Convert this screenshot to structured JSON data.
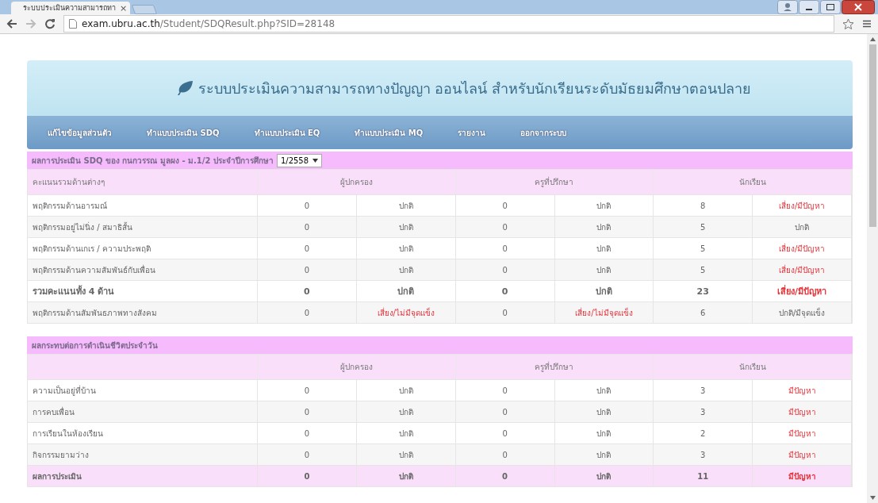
{
  "browser": {
    "tab": {
      "title": "ระบบประเมินความสามารถทา",
      "close": "×"
    },
    "url": {
      "host": "exam.ubru.ac.th",
      "path": "/Student/SDQResult.php?SID=28148"
    }
  },
  "header": {
    "title": "ระบบประเมินความสามารถทางปัญญา ออนไลน์ สำหรับนักเรียนระดับมัธยมศึกษาตอนปลาย"
  },
  "nav": [
    "แก้ไขข้อมูลส่วนตัว",
    "ทำแบบประเมิน SDQ",
    "ทำแบบประเมิน EQ",
    "ทำแบบประเมิน MQ",
    "รายงาน",
    "ออกจากระบบ"
  ],
  "tables": [
    {
      "title": "ผลการประเมิน SDQ ของ กนกวรรณ มูลผง - ม.1/2 ประจำปีการศึกษา",
      "term": "1/2558",
      "label_header": "คะแนนรวมด้านต่างๆ",
      "groups": [
        "ผู้ปกครอง",
        "ครูที่ปรึกษา",
        "นักเรียน"
      ],
      "rows": [
        {
          "kind": "normal",
          "label": "พฤติกรรมด้านอารมณ์",
          "cells": [
            {
              "text": "0",
              "alert": false
            },
            {
              "text": "ปกติ",
              "alert": false
            },
            {
              "text": "0",
              "alert": false
            },
            {
              "text": "ปกติ",
              "alert": false
            },
            {
              "text": "8",
              "alert": false
            },
            {
              "text": "เสี่ยง/มีปัญหา",
              "alert": true
            }
          ]
        },
        {
          "kind": "normal",
          "label": "พฤติกรรมอยู่ไม่นิ่ง / สมาธิสั้น",
          "cells": [
            {
              "text": "0",
              "alert": false
            },
            {
              "text": "ปกติ",
              "alert": false
            },
            {
              "text": "0",
              "alert": false
            },
            {
              "text": "ปกติ",
              "alert": false
            },
            {
              "text": "5",
              "alert": false
            },
            {
              "text": "ปกติ",
              "alert": false
            }
          ]
        },
        {
          "kind": "normal",
          "label": "พฤติกรรมด้านเกเร / ความประพฤติ",
          "cells": [
            {
              "text": "0",
              "alert": false
            },
            {
              "text": "ปกติ",
              "alert": false
            },
            {
              "text": "0",
              "alert": false
            },
            {
              "text": "ปกติ",
              "alert": false
            },
            {
              "text": "5",
              "alert": false
            },
            {
              "text": "เสี่ยง/มีปัญหา",
              "alert": true
            }
          ]
        },
        {
          "kind": "normal",
          "label": "พฤติกรรมด้านความสัมพันธ์กับเพื่อน",
          "cells": [
            {
              "text": "0",
              "alert": false
            },
            {
              "text": "ปกติ",
              "alert": false
            },
            {
              "text": "0",
              "alert": false
            },
            {
              "text": "ปกติ",
              "alert": false
            },
            {
              "text": "5",
              "alert": false
            },
            {
              "text": "เสี่ยง/มีปัญหา",
              "alert": true
            }
          ]
        },
        {
          "kind": "total",
          "label": "รวมคะแนนทั้ง 4 ด้าน",
          "cells": [
            {
              "text": "0",
              "alert": false
            },
            {
              "text": "ปกติ",
              "alert": false
            },
            {
              "text": "0",
              "alert": false
            },
            {
              "text": "ปกติ",
              "alert": false
            },
            {
              "text": "23",
              "alert": false
            },
            {
              "text": "เสี่ยง/มีปัญหา",
              "alert": true
            }
          ]
        },
        {
          "kind": "normal",
          "label": "พฤติกรรมด้านสัมพันธภาพทางสังคม",
          "cells": [
            {
              "text": "0",
              "alert": false
            },
            {
              "text": "เสี่ยง/ไม่มีจุดแข็ง",
              "alert": true
            },
            {
              "text": "0",
              "alert": false
            },
            {
              "text": "เสี่ยง/ไม่มีจุดแข็ง",
              "alert": true
            },
            {
              "text": "6",
              "alert": false
            },
            {
              "text": "ปกติ/มีจุดแข็ง",
              "alert": false
            }
          ]
        }
      ]
    },
    {
      "title": "ผลกระทบต่อการดำเนินชีวิตประจำวัน",
      "groups": [
        "ผู้ปกครอง",
        "ครูที่ปรึกษา",
        "นักเรียน"
      ],
      "rows": [
        {
          "kind": "normal",
          "label": "ความเป็นอยู่ที่บ้าน",
          "cells": [
            {
              "text": "0",
              "alert": false
            },
            {
              "text": "ปกติ",
              "alert": false
            },
            {
              "text": "0",
              "alert": false
            },
            {
              "text": "ปกติ",
              "alert": false
            },
            {
              "text": "3",
              "alert": false
            },
            {
              "text": "มีปัญหา",
              "alert": true
            }
          ]
        },
        {
          "kind": "normal",
          "label": "การคบเพื่อน",
          "cells": [
            {
              "text": "0",
              "alert": false
            },
            {
              "text": "ปกติ",
              "alert": false
            },
            {
              "text": "0",
              "alert": false
            },
            {
              "text": "ปกติ",
              "alert": false
            },
            {
              "text": "3",
              "alert": false
            },
            {
              "text": "มีปัญหา",
              "alert": true
            }
          ]
        },
        {
          "kind": "normal",
          "label": "การเรียนในห้องเรียน",
          "cells": [
            {
              "text": "0",
              "alert": false
            },
            {
              "text": "ปกติ",
              "alert": false
            },
            {
              "text": "0",
              "alert": false
            },
            {
              "text": "ปกติ",
              "alert": false
            },
            {
              "text": "2",
              "alert": false
            },
            {
              "text": "มีปัญหา",
              "alert": true
            }
          ]
        },
        {
          "kind": "normal",
          "label": "กิจกรรมยามว่าง",
          "cells": [
            {
              "text": "0",
              "alert": false
            },
            {
              "text": "ปกติ",
              "alert": false
            },
            {
              "text": "0",
              "alert": false
            },
            {
              "text": "ปกติ",
              "alert": false
            },
            {
              "text": "3",
              "alert": false
            },
            {
              "text": "มีปัญหา",
              "alert": true
            }
          ]
        },
        {
          "kind": "summary",
          "label": "ผลการประเมิน",
          "cells": [
            {
              "text": "0",
              "alert": false
            },
            {
              "text": "ปกติ",
              "alert": false
            },
            {
              "text": "0",
              "alert": false
            },
            {
              "text": "ปกติ",
              "alert": false
            },
            {
              "text": "11",
              "alert": false
            },
            {
              "text": "มีปัญหา",
              "alert": true
            }
          ]
        }
      ]
    }
  ]
}
